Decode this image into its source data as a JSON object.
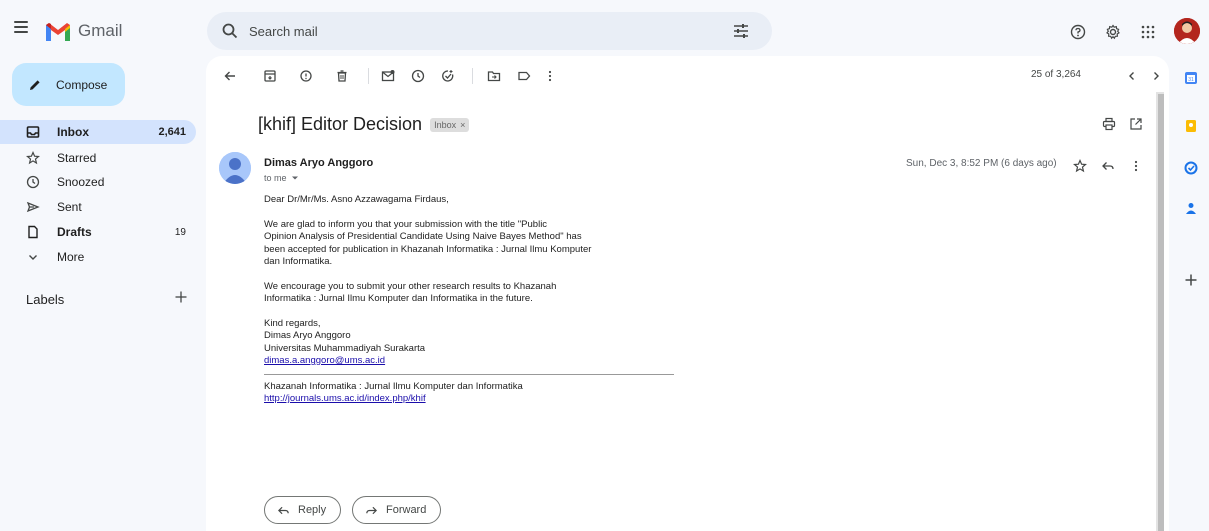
{
  "app": {
    "name": "Gmail"
  },
  "search": {
    "placeholder": "Search mail"
  },
  "compose": {
    "label": "Compose"
  },
  "sidebar": {
    "items": [
      {
        "label": "Inbox",
        "count": "2,641",
        "icon": "inbox-icon"
      },
      {
        "label": "Starred",
        "count": "",
        "icon": "star-icon"
      },
      {
        "label": "Snoozed",
        "count": "",
        "icon": "clock-icon"
      },
      {
        "label": "Sent",
        "count": "",
        "icon": "send-icon"
      },
      {
        "label": "Drafts",
        "count": "19",
        "icon": "draft-icon"
      },
      {
        "label": "More",
        "count": "",
        "icon": "chevron-down-icon"
      }
    ],
    "labels_title": "Labels"
  },
  "toolbar": {
    "pagination": "25 of 3,264"
  },
  "email": {
    "subject": "[khif] Editor Decision",
    "chip": "Inbox",
    "chip_close": "×",
    "sender": "Dimas Aryo Anggoro",
    "to": "to me",
    "date": "Sun, Dec 3, 8:52 PM (6 days ago)",
    "greeting": "Dear Dr/Mr/Ms. Asno Azzawagama Firdaus,",
    "p1_l1": "We are glad to inform you that your submission with the title \"Public",
    "p1_l2": "Opinion Analysis of Presidential Candidate Using Naive Bayes Method\" has",
    "p1_l3": "been accepted for publication in Khazanah Informatika : Jurnal Ilmu Komputer",
    "p1_l4": "dan Informatika.",
    "p2_l1": "We encourage you to submit your other research results to Khazanah",
    "p2_l2": "Informatika : Jurnal Ilmu Komputer dan Informatika in the future.",
    "sig_l1": "Kind regards,",
    "sig_l2": "Dimas Aryo Anggoro",
    "sig_l3": "Universitas Muhammadiyah Surakarta",
    "sig_email": "dimas.a.anggoro@ums.ac.id",
    "journal": "Khazanah Informatika : Jurnal Ilmu Komputer dan Informatika",
    "journal_url": "http://journals.ums.ac.id/index.php/khif"
  },
  "actions": {
    "reply": "Reply",
    "forward": "Forward"
  },
  "colors": {
    "accent": "#0b57d0",
    "compose": "#c2e7ff",
    "active_nav": "#d3e3fd",
    "link": "#1a0dab"
  }
}
